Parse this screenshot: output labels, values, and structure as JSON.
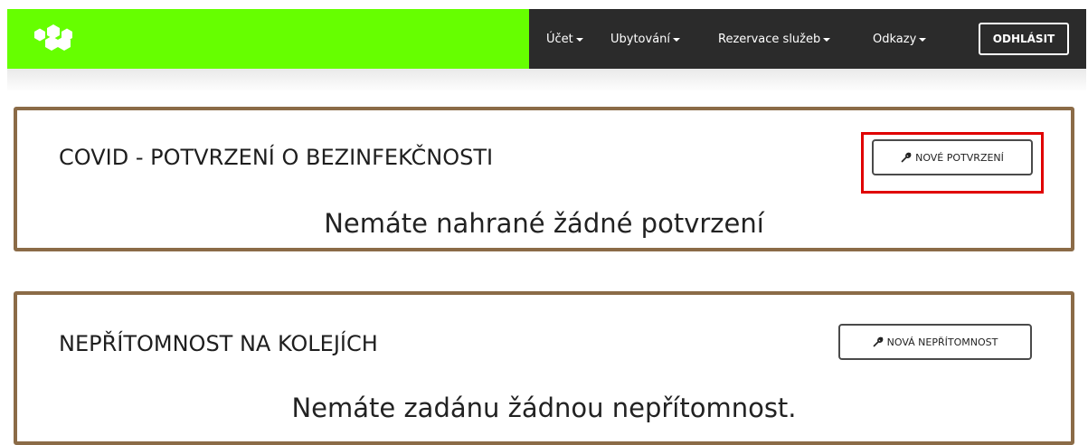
{
  "nav": {
    "items": [
      {
        "label": "Účet"
      },
      {
        "label": "Ubytování"
      },
      {
        "label": "Rezervace služeb"
      },
      {
        "label": "Odkazy"
      }
    ],
    "logout_label": "ODHLÁSIT"
  },
  "panels": [
    {
      "title": "COVID - POTVRZENÍ O BEZINFEKČNOSTI",
      "button_label": "NOVÉ POTVRZENÍ",
      "button_icon": "wrench-icon",
      "message": "Nemáte nahrané žádné potvrzení"
    },
    {
      "title": "NEPŘÍTOMNOST NA KOLEJÍCH",
      "button_label": "NOVÁ NEPŘÍTOMNOST",
      "button_icon": "wrench-icon",
      "message": "Nemáte zadánu žádnou nepřítomnost."
    }
  ],
  "colors": {
    "brand": "#66ff00",
    "nav_bg": "#2b2b2b",
    "panel_border": "#8b6b47",
    "highlight": "#e00000"
  }
}
